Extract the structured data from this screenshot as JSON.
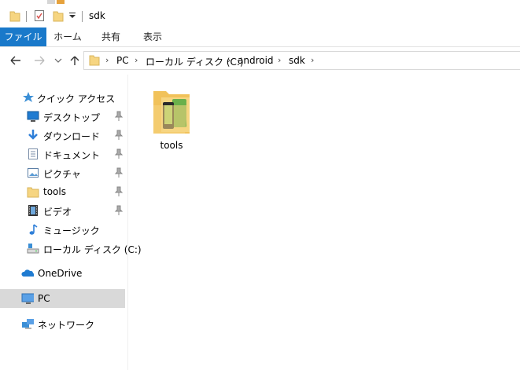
{
  "window": {
    "title": "sdk"
  },
  "ribbon": {
    "tabs": [
      {
        "label": "ファイル"
      },
      {
        "label": "ホーム"
      },
      {
        "label": "共有"
      },
      {
        "label": "表示"
      }
    ]
  },
  "address": {
    "crumbs": [
      "PC",
      "ローカル ディスク (C:)",
      "android",
      "sdk"
    ]
  },
  "nav": {
    "quick_access": "クイック アクセス",
    "items": [
      {
        "label": "デスクトップ",
        "icon": "desktop-icon",
        "pinned": true
      },
      {
        "label": "ダウンロード",
        "icon": "download-icon",
        "pinned": true
      },
      {
        "label": "ドキュメント",
        "icon": "document-icon",
        "pinned": true
      },
      {
        "label": "ピクチャ",
        "icon": "pictures-icon",
        "pinned": true
      },
      {
        "label": "tools",
        "icon": "folder-icon",
        "pinned": true
      },
      {
        "label": "ビデオ",
        "icon": "video-icon",
        "pinned": true
      },
      {
        "label": "ミュージック",
        "icon": "music-icon",
        "pinned": false
      },
      {
        "label": "ローカル ディスク (C:)",
        "icon": "drive-icon",
        "pinned": false
      }
    ],
    "onedrive": "OneDrive",
    "pc": "PC",
    "network": "ネットワーク"
  },
  "content": {
    "items": [
      {
        "name": "tools",
        "icon": "android-folder-icon"
      }
    ]
  },
  "colors": {
    "file_tab": "#1979ca",
    "selected_nav": "#d9d9d9",
    "folder": "#f6d581",
    "android_green": "#6ab04c"
  }
}
